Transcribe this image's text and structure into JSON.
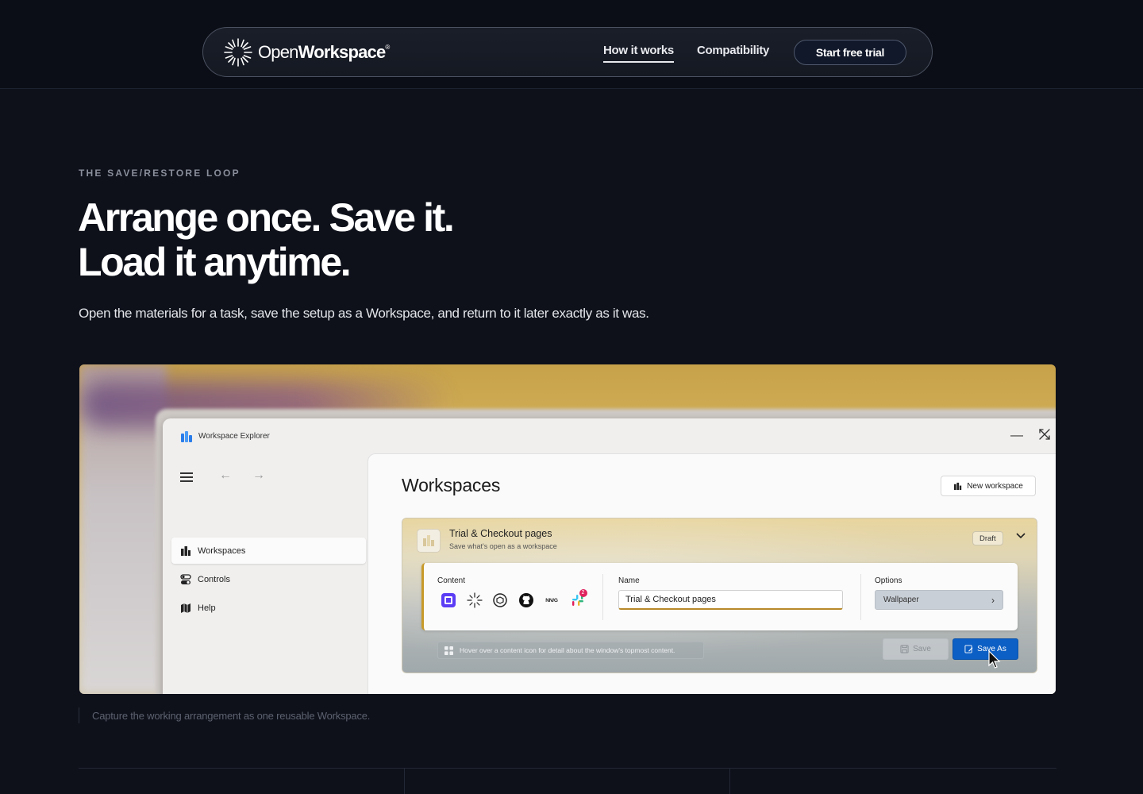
{
  "nav": {
    "logo_light": "Open",
    "logo_bold": "Workspace",
    "logo_mark": "®",
    "links": [
      "How it works",
      "Compatibility"
    ],
    "cta": "Start free trial"
  },
  "hero": {
    "eyebrow": "THE SAVE/RESTORE LOOP",
    "headline": "Arrange once. Save it. Load it anytime.",
    "lead": "Open the materials for a task, save the setup as a Workspace, and return to it later exactly as it was."
  },
  "app": {
    "title": "Workspace Explorer",
    "sidebar": [
      "Workspaces",
      "Controls",
      "Help"
    ],
    "pane_title": "Workspaces",
    "new_button": "New workspace",
    "card": {
      "title": "Trial & Checkout pages",
      "subtitle": "Save what's open as a workspace",
      "badge": "Draft",
      "content_label": "Content",
      "content_icons": [
        "note-app-icon",
        "openworkspace-icon",
        "openai-icon",
        "github-icon",
        "nngroup-icon",
        "slack-icon"
      ],
      "nngroup_text": "NN/G",
      "slack_badge": "2",
      "name_label": "Name",
      "name_value": "Trial & Checkout pages",
      "options_label": "Options",
      "option_value": "Wallpaper",
      "hint": "Hover over a content icon for detail about the window's topmost content.",
      "save": "Save",
      "save_as": "Save As"
    }
  },
  "caption": "Capture the working arrangement as one reusable Workspace.",
  "colors": {
    "page_bg": "#0e111a",
    "accent_blue": "#0c5fc4",
    "accent_gold": "#c89a2a"
  }
}
